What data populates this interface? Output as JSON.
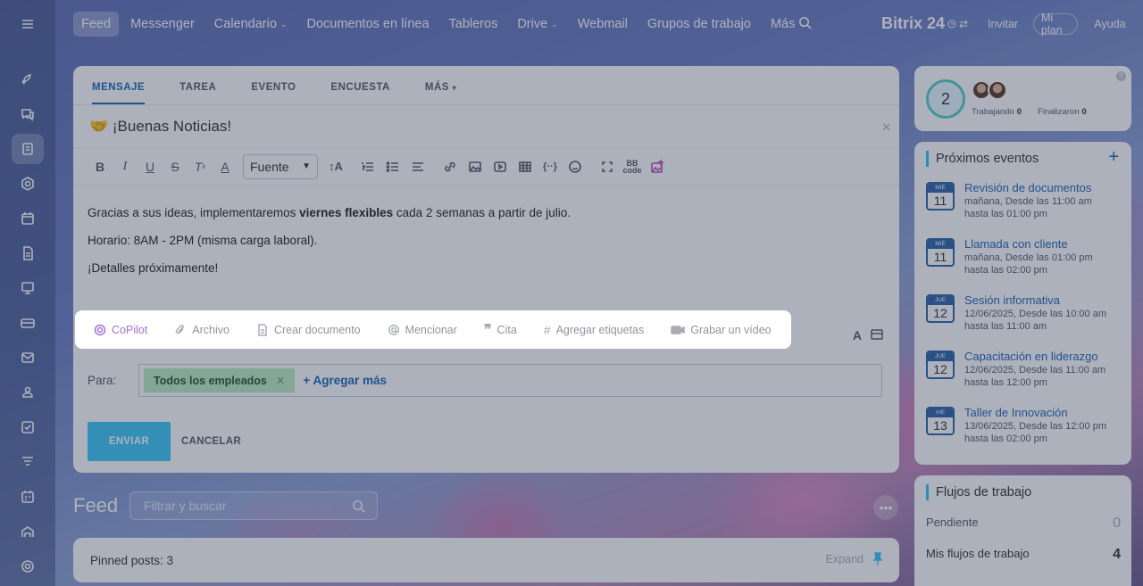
{
  "topnav": {
    "items": [
      {
        "label": "Feed",
        "caret": false
      },
      {
        "label": "Messenger",
        "caret": false
      },
      {
        "label": "Calendario",
        "caret": true
      },
      {
        "label": "Documentos en línea",
        "caret": false
      },
      {
        "label": "Tableros",
        "caret": false
      },
      {
        "label": "Drive",
        "caret": true
      },
      {
        "label": "Webmail",
        "caret": false
      },
      {
        "label": "Grupos de trabajo",
        "caret": false
      },
      {
        "label": "Más",
        "caret": true
      }
    ],
    "brand": "Bitrix 24",
    "invite": "Invitar",
    "plan": "Mi plan",
    "help": "Ayuda"
  },
  "composer": {
    "tabs": [
      "MENSAJE",
      "TAREA",
      "EVENTO",
      "ENCUESTA",
      "MÁS"
    ],
    "title": "🤝 ¡Buenas Noticias!",
    "font_select": "Fuente",
    "body": {
      "line1_pre": "Gracias a sus ideas, implementaremos ",
      "line1_bold": "viernes flexibles",
      "line1_post": " cada 2 semanas a partir de julio.",
      "line2": "Horario: 8AM - 2PM (misma carga laboral).",
      "line3": "¡Detalles próximamente!"
    },
    "actions": {
      "copilot": "CoPilot",
      "file": "Archivo",
      "create_doc": "Crear documento",
      "mention": "Mencionar",
      "quote": "Cita",
      "tags": "Agregar etiquetas",
      "video": "Grabar un vídeo"
    },
    "recipients_label": "Para:",
    "recipient_chip": "Todos los empleados",
    "add_more": "+ Agregar más",
    "send": "ENVIAR",
    "cancel": "CANCELAR"
  },
  "feed": {
    "title": "Feed",
    "search_placeholder": "Filtrar y buscar",
    "pinned": "Pinned posts: 3",
    "expand": "Expand"
  },
  "status_widget": {
    "count": "2",
    "working_label": "Trabajando",
    "working_value": "0",
    "finished_label": "Finalizaron",
    "finished_value": "0"
  },
  "events_widget": {
    "title": "Próximos eventos",
    "events": [
      {
        "weekday": "MIÉ",
        "day": "11",
        "title": "Revisión de documentos",
        "line1": "mañana, Desde las 11:00 am",
        "line2": "hasta las 01:00 pm"
      },
      {
        "weekday": "MIÉ",
        "day": "11",
        "title": "Llamada con cliente",
        "line1": "mañana, Desde las 01:00 pm",
        "line2": "hasta las 02:00 pm"
      },
      {
        "weekday": "JUE",
        "day": "12",
        "title": "Sesión informativa",
        "line1": "12/06/2025, Desde las 10:00 am",
        "line2": "hasta las 11:00 am"
      },
      {
        "weekday": "JUE",
        "day": "12",
        "title": "Capacitación en liderazgo",
        "line1": "12/06/2025, Desde las 11:00 am",
        "line2": "hasta las 12:00 pm"
      },
      {
        "weekday": "VIE",
        "day": "13",
        "title": "Taller de Innovación",
        "line1": "13/06/2025, Desde las 12:00 pm",
        "line2": "hasta las 02:00 pm"
      }
    ]
  },
  "flows_widget": {
    "title": "Flujos de trabajo",
    "pending_label": "Pendiente",
    "pending_value": "0",
    "mine_label": "Mis flujos de trabajo",
    "mine_value": "4"
  },
  "colors": {
    "accent": "#2066b0",
    "send": "#3bc8f5",
    "chip": "#bcedc1",
    "copilot": "#a271df"
  }
}
